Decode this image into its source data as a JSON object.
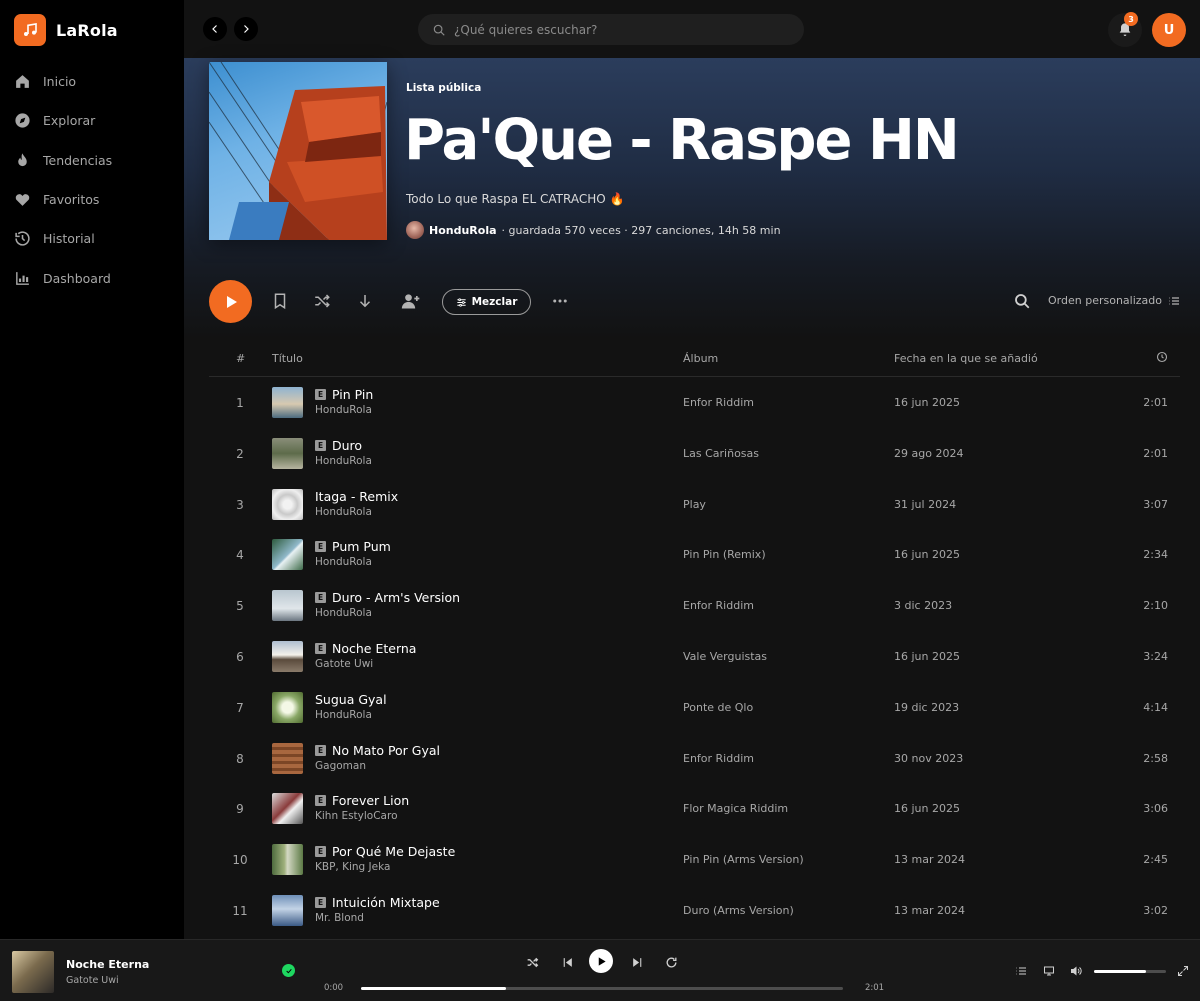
{
  "app": {
    "name": "LaRola",
    "accent": "#f26b21"
  },
  "sidebar": {
    "items": [
      {
        "label": "Inicio",
        "icon": "home-icon"
      },
      {
        "label": "Explorar",
        "icon": "compass-icon"
      },
      {
        "label": "Tendencias",
        "icon": "fire-icon"
      },
      {
        "label": "Favoritos",
        "icon": "heart-icon"
      },
      {
        "label": "Historial",
        "icon": "history-icon"
      },
      {
        "label": "Dashboard",
        "icon": "chart-icon"
      }
    ]
  },
  "topbar": {
    "search_placeholder": "¿Qué quieres escuchar?",
    "notifications_count": "3",
    "avatar_initial": "U"
  },
  "playlist": {
    "label": "Lista pública",
    "title": "Pa'Que - Raspe HN",
    "description": "Todo Lo que Raspa EL CATRACHO 🔥",
    "owner": "HonduRola",
    "stats": "· guardada 570 veces · 297 canciones, 14h 58 min"
  },
  "actions": {
    "mix_label": "Mezclar",
    "sort_label": "Orden personalizado"
  },
  "table": {
    "headers": {
      "num": "#",
      "title": "Título",
      "album": "Álbum",
      "date": "Fecha en la que se añadió"
    },
    "explicit_label": "E",
    "rows": [
      {
        "num": "1",
        "title": "Pin Pin",
        "artist": "HonduRola",
        "album": "Enfor Riddim",
        "date": "16 jun 2025",
        "duration": "2:01",
        "explicit": true
      },
      {
        "num": "2",
        "title": "Duro",
        "artist": "HonduRola",
        "album": "Las Cariñosas",
        "date": "29 ago 2024",
        "duration": "2:01",
        "explicit": true
      },
      {
        "num": "3",
        "title": "Itaga - Remix",
        "artist": "HonduRola",
        "album": "Play",
        "date": "31 jul 2024",
        "duration": "3:07",
        "explicit": false
      },
      {
        "num": "4",
        "title": "Pum Pum",
        "artist": "HonduRola",
        "album": "Pin Pin (Remix)",
        "date": "16 jun 2025",
        "duration": "2:34",
        "explicit": true
      },
      {
        "num": "5",
        "title": "Duro - Arm's Version",
        "artist": "HonduRola",
        "album": "Enfor Riddim",
        "date": "3 dic 2023",
        "duration": "2:10",
        "explicit": true
      },
      {
        "num": "6",
        "title": "Noche Eterna",
        "artist": "Gatote Uwi",
        "album": "Vale Verguistas",
        "date": "16 jun 2025",
        "duration": "3:24",
        "explicit": true
      },
      {
        "num": "7",
        "title": "Sugua Gyal",
        "artist": "HonduRola",
        "album": "Ponte de Qlo",
        "date": "19 dic 2023",
        "duration": "4:14",
        "explicit": false
      },
      {
        "num": "8",
        "title": "No Mato Por Gyal",
        "artist": "Gagoman",
        "album": "Enfor Riddim",
        "date": "30 nov 2023",
        "duration": "2:58",
        "explicit": true
      },
      {
        "num": "9",
        "title": "Forever Lion",
        "artist": "Kihn EstyloCaro",
        "album": "Flor Magica Riddim",
        "date": "16 jun 2025",
        "duration": "3:06",
        "explicit": true
      },
      {
        "num": "10",
        "title": "Por Qué Me Dejaste",
        "artist": "KBP, King Jeka",
        "album": "Pin Pin (Arms Version)",
        "date": "13 mar 2024",
        "duration": "2:45",
        "explicit": true
      },
      {
        "num": "11",
        "title": "Intuición Mixtape",
        "artist": "Mr. Blond",
        "album": "Duro (Arms Version)",
        "date": "13 mar 2024",
        "duration": "3:02",
        "explicit": true
      }
    ]
  },
  "player": {
    "title": "Noche Eterna",
    "artist": "Gatote Uwi",
    "time_current": "0:00",
    "time_total": "2:01",
    "progress": 0.3,
    "volume": 0.72
  }
}
